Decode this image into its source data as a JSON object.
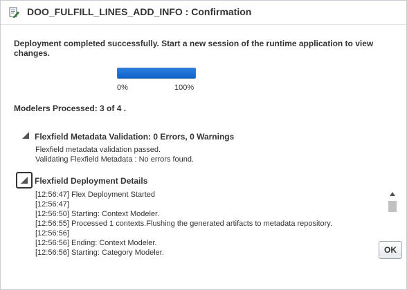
{
  "dialog": {
    "title": "DOO_FULFILL_LINES_ADD_INFO : Confirmation",
    "title_icon": "document-edit-icon"
  },
  "message": "Deployment completed successfully.  Start a new session of the runtime application to view changes.",
  "progress": {
    "value_percent": 100,
    "min_label": "0%",
    "max_label": "100%",
    "fill_color": "#1769d4"
  },
  "modelers_status": "Modelers Processed: 3 of 4 .",
  "validation_section": {
    "title": "Flexfield Metadata Validation: 0 Errors, 0 Warnings",
    "expanded": true,
    "lines": [
      "Flexfield metadata validation passed.",
      "Validating Flexfield Metadata : No errors found."
    ]
  },
  "details_section": {
    "title": "Flexfield Deployment Details",
    "expanded": true,
    "log_lines": [
      "[12:56:47] Flex Deployment Started",
      "[12:56:47]",
      "[12:56:50] Starting: Context Modeler.",
      "[12:56:55] Processed 1 contexts.Flushing the generated artifacts to metadata repository.",
      "[12:56:56]",
      "[12:56:56] Ending: Context Modeler.",
      "[12:56:56] Starting: Category Modeler."
    ]
  },
  "buttons": {
    "ok_label": "OK"
  }
}
